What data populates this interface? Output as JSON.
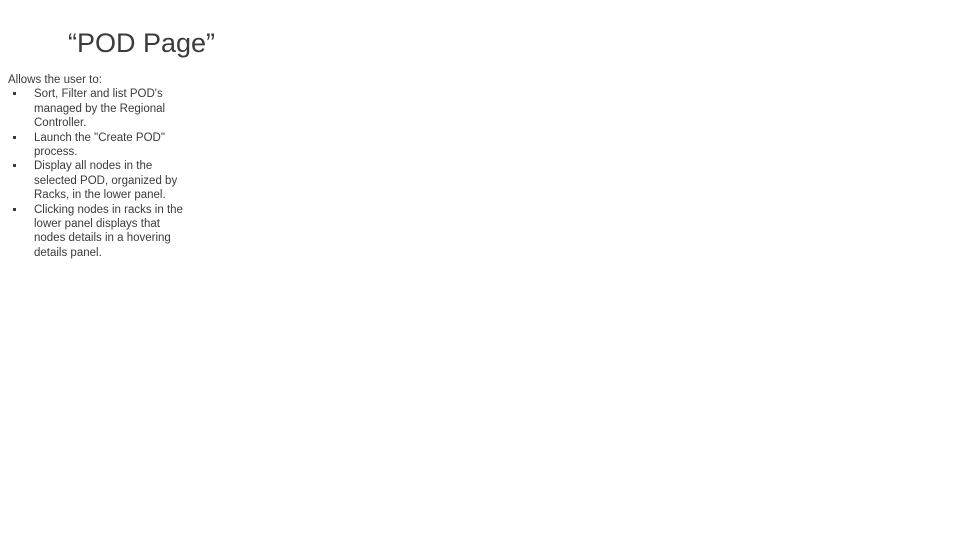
{
  "slide": {
    "title": "“POD Page”",
    "intro": "Allows the user to:",
    "bullets": [
      {
        "text": "Sort, Filter and list POD's managed by the Regional Controller."
      },
      {
        "text": "Launch the \"Create POD\" process."
      },
      {
        "text": "Display all nodes in the selected POD, organized by Racks, in the lower panel."
      },
      {
        "text": "Clicking nodes in racks in the lower panel displays that nodes details in a hovering details panel."
      }
    ],
    "colors": {
      "background": "#ffffff",
      "text": "#3b3b3b"
    }
  }
}
